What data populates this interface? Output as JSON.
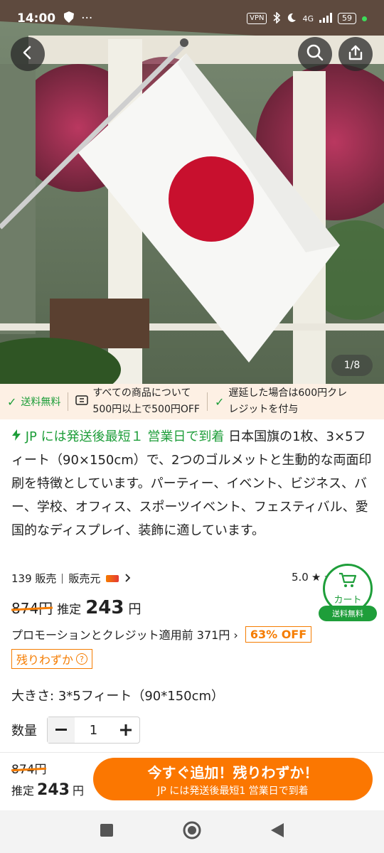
{
  "status_bar": {
    "time": "14:00",
    "dots": "···",
    "vpn": "VPN",
    "network": "4G",
    "battery": "59"
  },
  "gallery": {
    "counter": "1/8"
  },
  "benefits": {
    "free_shipping": "送料無料",
    "coupon_line1": "すべての商品について",
    "coupon_line2": "500円以上で500円OFF",
    "delay_line1": "遅延した場合は600円クレ",
    "delay_line2": "レジットを付与"
  },
  "description": {
    "fast_label": "JP には発送後最短１ 営業日で到着",
    "text": "日本国旗の1枚、3×5フィート（90×150cm）で、2つのゴルメットと生動的な両面印刷を特徴としています。パーティー、イベント、ビジネス、バー、学校、オフィス、スポーツイベント、フェスティバル、愛国的なディスプレイ、装飾に適しています。"
  },
  "meta": {
    "sold": "139 販売",
    "seller": "販売元",
    "rating": "5.0"
  },
  "cart": {
    "label": "カート",
    "free_badge": "送料無料"
  },
  "price": {
    "old": "874円",
    "est_label": "推定",
    "now": "243",
    "yen": "円",
    "promo_text": "プロモーションとクレジット適用前",
    "promo_price": "371円",
    "off_badge": "63% OFF",
    "low_stock": "残りわずか"
  },
  "options": {
    "size_label": "大きさ:",
    "size_value": "3*5フィート（90*150cm）",
    "qty_label": "数量",
    "qty_value": "1"
  },
  "bottom_bar": {
    "old": "874円",
    "est_label": "推定",
    "now": "243",
    "yen": "円",
    "add_main": "今すぐ追加！残りわずか！",
    "add_sub": "JP には発送後最短1 営業日で到着"
  },
  "colors": {
    "accent_orange": "#fb7701",
    "green": "#1e9e3a",
    "flag_red": "#c8102e"
  }
}
